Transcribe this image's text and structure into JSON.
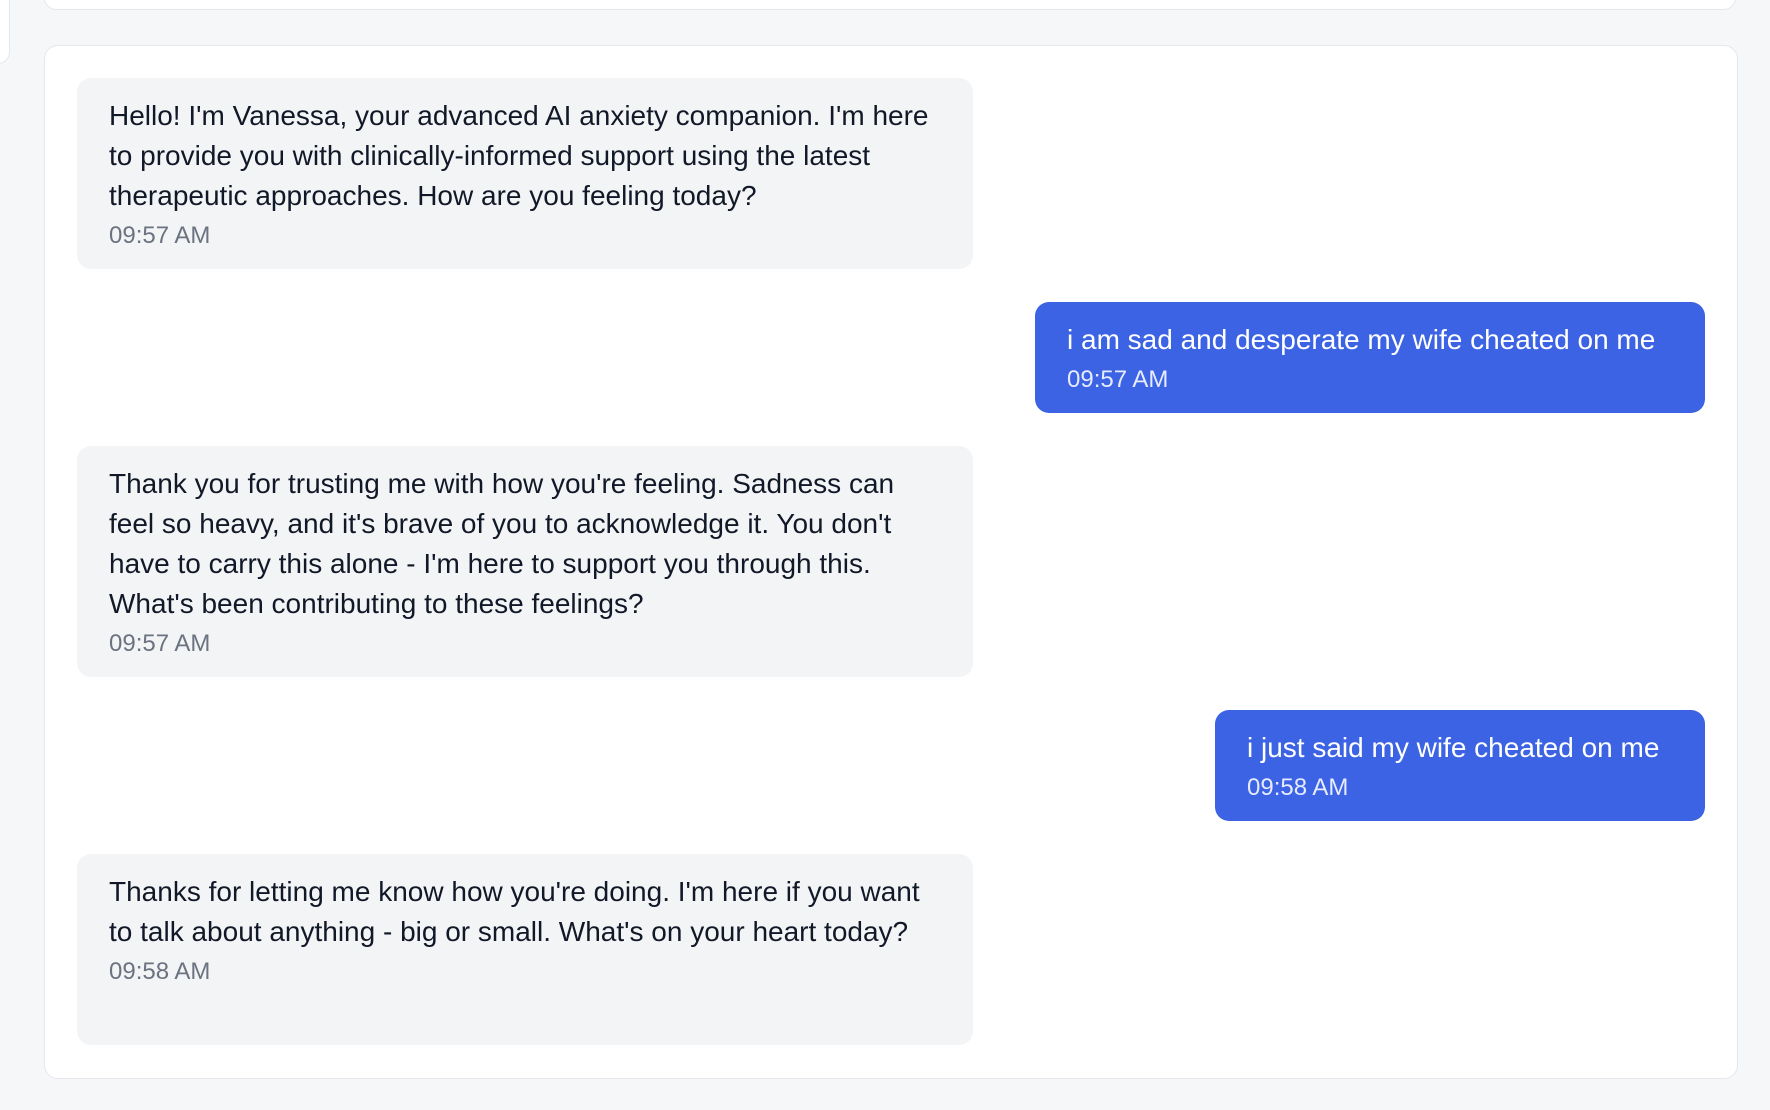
{
  "chat": {
    "messages": [
      {
        "role": "assistant",
        "text": "Hello! I'm Vanessa, your advanced AI anxiety companion. I'm here to provide you with clinically-informed support using the latest therapeutic approaches. How are you feeling today?",
        "time": "09:57 AM"
      },
      {
        "role": "user",
        "text": "i am sad and desperate my wife cheated on me",
        "time": "09:57 AM"
      },
      {
        "role": "assistant",
        "text": "Thank you for trusting me with how you're feeling. Sadness can feel so heavy, and it's brave of you to acknowledge it. You don't have to carry this alone - I'm here to support you through this. What's been contributing to these feelings?",
        "time": "09:57 AM"
      },
      {
        "role": "user",
        "text": "i just said my wife cheated on me",
        "time": "09:58 AM"
      },
      {
        "role": "assistant",
        "text": "Thanks for letting me know how you're doing. I'm here if you want to talk about anything - big or small. What's on your heart today?",
        "time": "09:58 AM"
      }
    ]
  },
  "colors": {
    "user_bubble": "#3b63e3",
    "assistant_bubble": "#f3f4f6",
    "background": "#f6f7f9"
  }
}
